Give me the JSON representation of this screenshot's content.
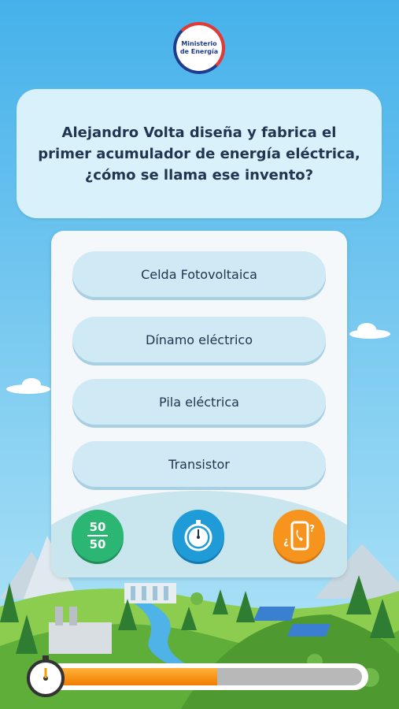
{
  "logo": {
    "line1": "Ministerio",
    "line2": "de Energía"
  },
  "question": {
    "text": "Alejandro Volta diseña y fabrica el primer acumulador de energía eléctrica, ¿cómo se llama ese invento?"
  },
  "options": [
    {
      "label": "Celda Fotovoltaica"
    },
    {
      "label": "Dínamo eléctrico"
    },
    {
      "label": "Pila eléctrica"
    },
    {
      "label": "Transistor"
    }
  ],
  "lifelines": [
    {
      "icon": "fifty-fifty-icon",
      "top": "50",
      "bottom": "50",
      "color": "#2bb673"
    },
    {
      "icon": "stopwatch-icon",
      "color": "#1f9bd7"
    },
    {
      "icon": "phone-call-icon",
      "color": "#f7941d"
    }
  ],
  "timer": {
    "progress": 0.53,
    "fill_color": "#f28a0c",
    "track_color": "#b8b8b8"
  },
  "colors": {
    "sky_top": "#4fb6ec",
    "sky_bottom": "#a8e1f7",
    "grass": "#7cc043",
    "question_bg": "#d9f1fb",
    "option_bg": "#cfe9f5"
  }
}
